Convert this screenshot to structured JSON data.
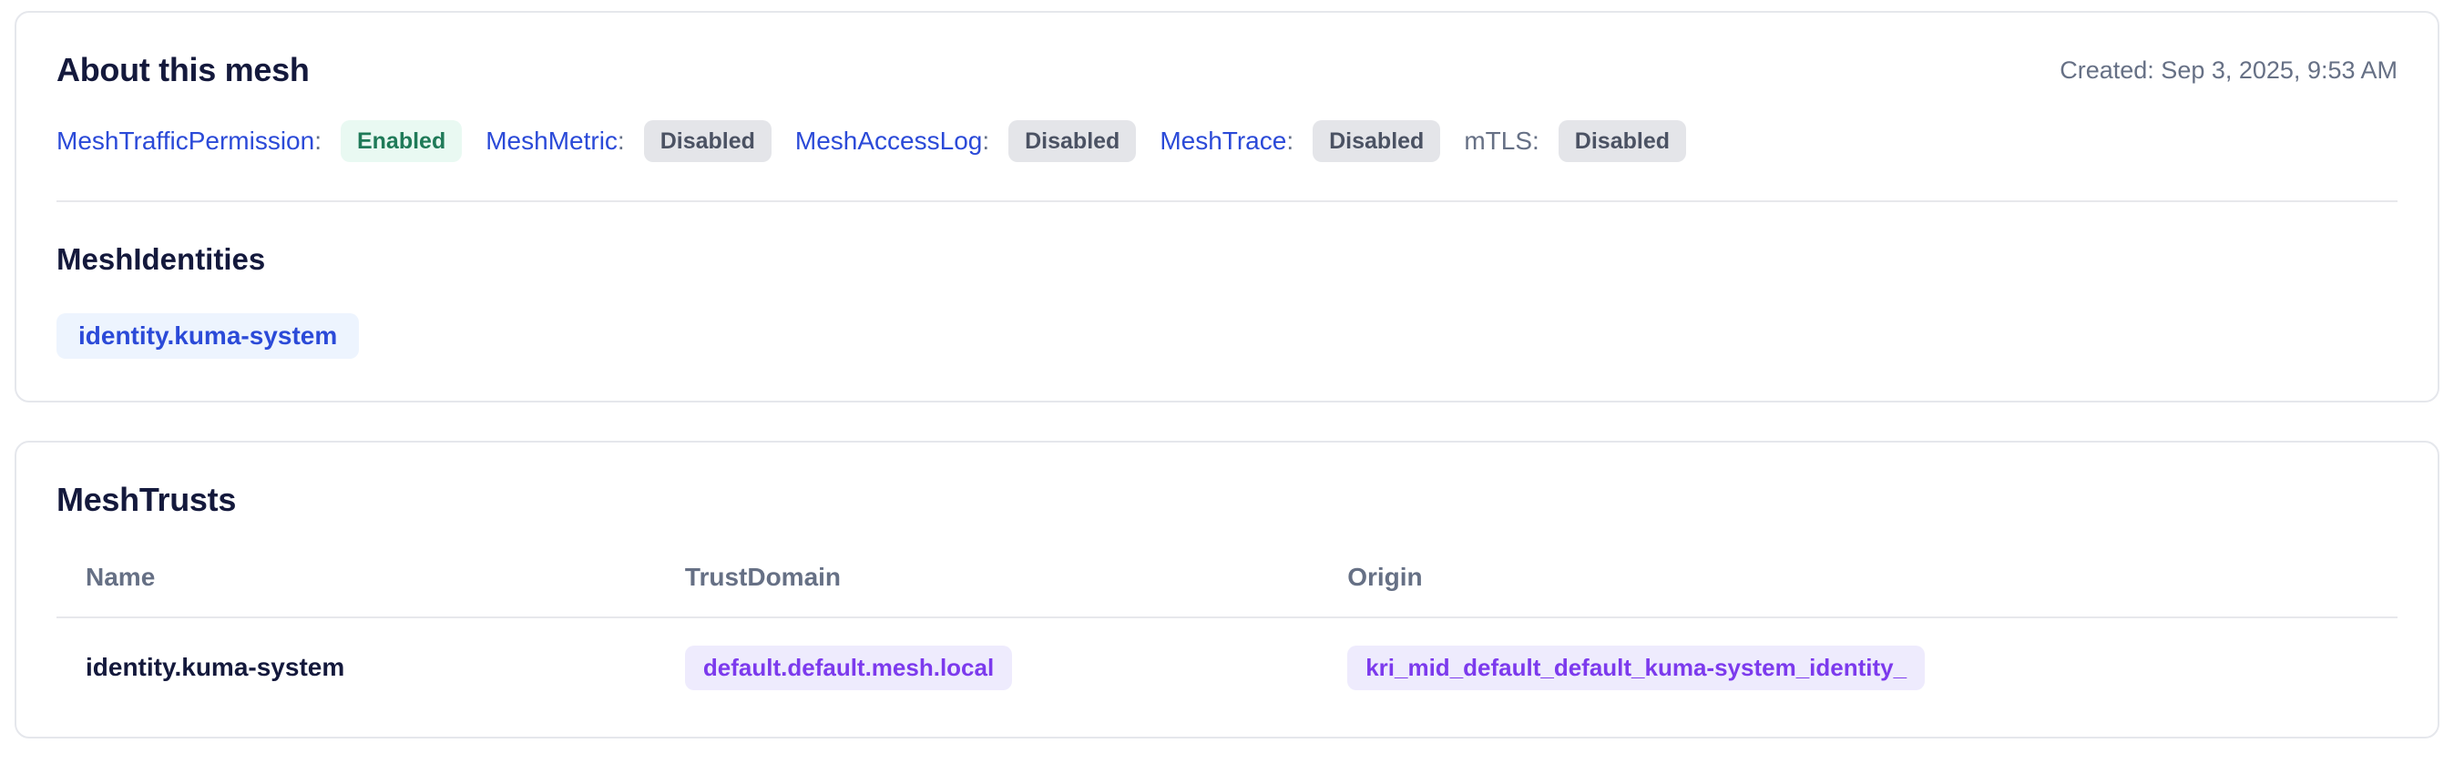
{
  "ui": {
    "colon": ":"
  },
  "colors": {
    "link_blue": "#2b4ad8",
    "enabled_green_text": "#1f7a58",
    "enabled_green_bg": "#e9f9f2",
    "disabled_gray_text": "#4b5263",
    "disabled_gray_bg": "#e4e5e9",
    "identity_blue_bg": "#edf4fe",
    "purple_text": "#7c3aed",
    "purple_bg": "#eeebfd",
    "heading_navy": "#14193c",
    "muted_gray": "#667085",
    "card_border": "#e5e7ec"
  },
  "about_card": {
    "title": "About this mesh",
    "created_label": "Created: Sep 3, 2025, 9:53 AM",
    "features": [
      {
        "label": "MeshTrafficPermission",
        "status": "Enabled"
      },
      {
        "label": "MeshMetric",
        "status": "Disabled"
      },
      {
        "label": "MeshAccessLog",
        "status": "Disabled"
      },
      {
        "label": "MeshTrace",
        "status": "Disabled"
      },
      {
        "label": "mTLS",
        "status": "Disabled"
      }
    ],
    "identities": {
      "heading": "MeshIdentities",
      "items": [
        "identity.kuma-system"
      ]
    }
  },
  "trusts_card": {
    "title": "MeshTrusts",
    "table": {
      "columns": [
        "Name",
        "TrustDomain",
        "Origin"
      ],
      "rows": [
        {
          "name": "identity.kuma-system",
          "trust_domain": "default.default.mesh.local",
          "origin": "kri_mid_default_default_kuma-system_identity_"
        }
      ]
    }
  }
}
